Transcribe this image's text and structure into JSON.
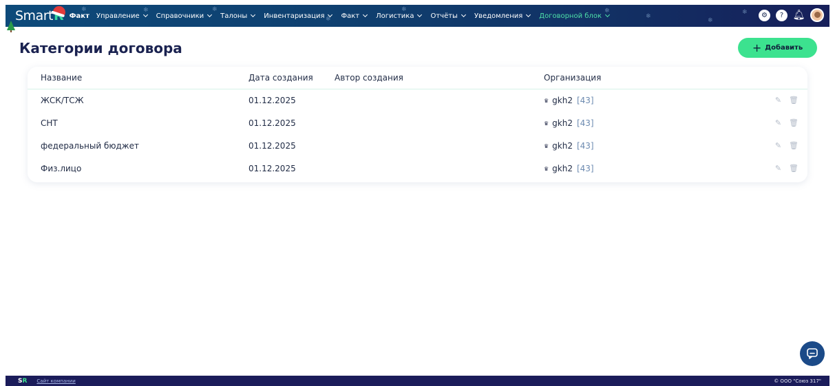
{
  "app": {
    "logo_text": "Smart",
    "logo_suffix": "R",
    "logo_sub": "Факт"
  },
  "nav": {
    "items": [
      {
        "label": "Управление",
        "active": false
      },
      {
        "label": "Справочники",
        "active": false
      },
      {
        "label": "Талоны",
        "active": false
      },
      {
        "label": "Инвентаризация",
        "active": false
      },
      {
        "label": "Факт",
        "active": false
      },
      {
        "label": "Логистика",
        "active": false
      },
      {
        "label": "Отчёты",
        "active": false
      },
      {
        "label": "Уведомления",
        "active": false
      },
      {
        "label": "Договорной блок",
        "active": true
      }
    ]
  },
  "header_icons": [
    "settings-icon",
    "help-icon",
    "bell-icon",
    "avatar"
  ],
  "page": {
    "title": "Категории договора",
    "add_button": "Добавить"
  },
  "table": {
    "columns": {
      "name": "Название",
      "created": "Дата создания",
      "author": "Автор создания",
      "org": "Организация"
    },
    "rows": [
      {
        "name": "ЖСК/ТСЖ",
        "created": "01.12.2025",
        "author": "",
        "org_name": "gkh2",
        "org_id": "[43]"
      },
      {
        "name": "СНТ",
        "created": "01.12.2025",
        "author": "",
        "org_name": "gkh2",
        "org_id": "[43]"
      },
      {
        "name": "федеральный бюджет",
        "created": "01.12.2025",
        "author": "",
        "org_name": "gkh2",
        "org_id": "[43]"
      },
      {
        "name": "Физ.лицо",
        "created": "01.12.2025",
        "author": "",
        "org_name": "gkh2",
        "org_id": "[43]"
      }
    ]
  },
  "footer": {
    "logo_s": "S",
    "logo_r": "R",
    "link": "Сайт компании",
    "copyright": "© ООО \"Союз 317\""
  },
  "colors": {
    "accent": "#3ce28f",
    "nav_active": "#4ee0a8",
    "title": "#1a2250",
    "footer_bg": "#1b1c5a"
  }
}
